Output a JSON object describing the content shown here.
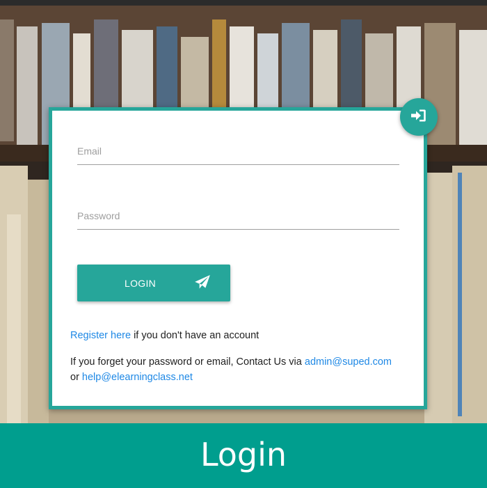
{
  "login_form": {
    "email_placeholder": "Email",
    "password_placeholder": "Password",
    "submit_label": "LOGIN",
    "fab_icon": "sign-in-icon",
    "submit_icon": "paper-plane-icon"
  },
  "register": {
    "link_text": "Register here",
    "suffix_text": " if you don't have an account"
  },
  "contact": {
    "prefix_text": "If you forget your password or email, Contact Us via ",
    "email_primary": "admin@suped.com",
    "or_text": "or ",
    "email_secondary": "help@elearningclass.net"
  },
  "footer": {
    "title": "Login"
  },
  "colors": {
    "accent": "#26a69a",
    "footer": "#009e8e",
    "link": "#1e88e5"
  }
}
